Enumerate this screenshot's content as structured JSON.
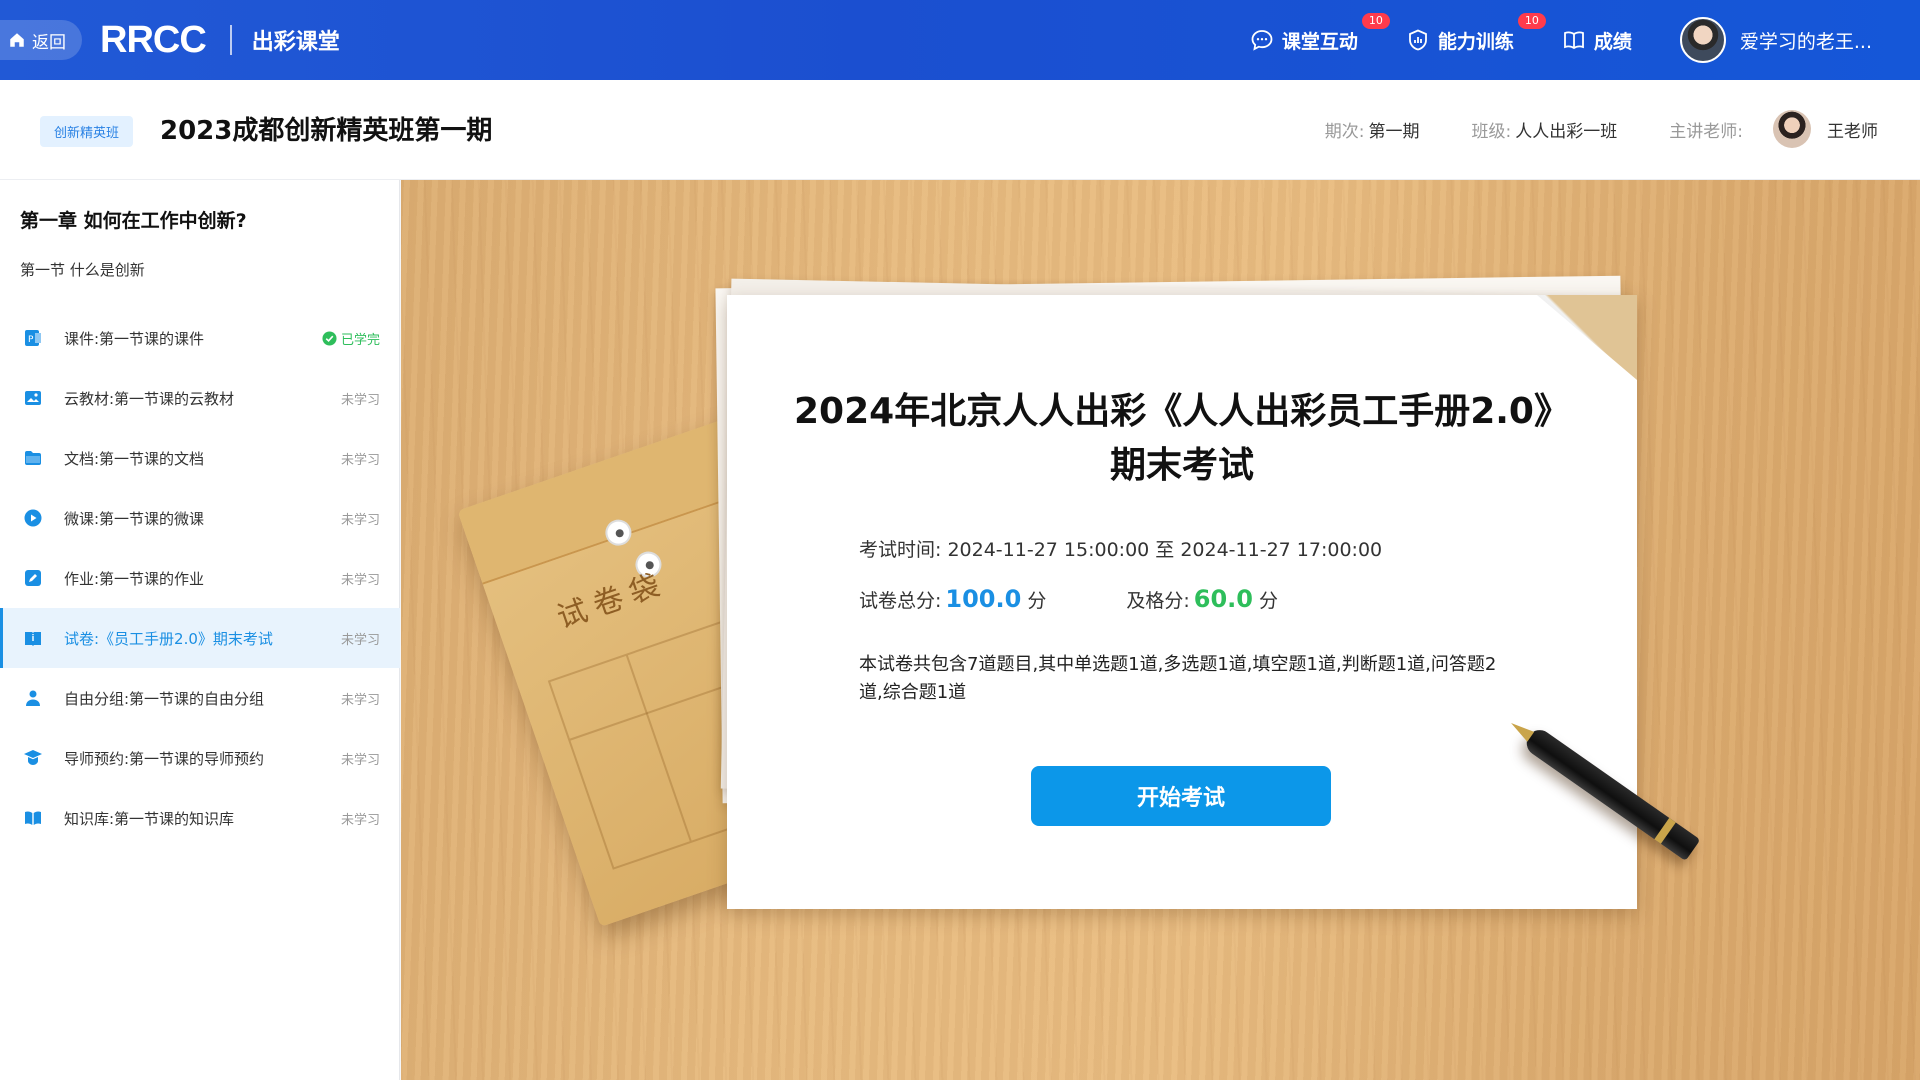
{
  "topbar": {
    "back_label": "返回",
    "logo_text": "RRCC",
    "logo_subtitle": "出彩课堂",
    "nav": [
      {
        "label": "课堂互动",
        "badge": "10"
      },
      {
        "label": "能力训练",
        "badge": "10"
      },
      {
        "label": "成绩",
        "badge": ""
      }
    ],
    "user_name": "爱学习的老王..."
  },
  "course": {
    "tag": "创新精英班",
    "title": "2023成都创新精英班第一期",
    "period_label": "期次:",
    "period_value": "第一期",
    "class_label": "班级:",
    "class_value": "人人出彩一班",
    "teacher_label": "主讲老师:",
    "teacher_value": "王老师"
  },
  "sidebar": {
    "chapter": "第一章  如何在工作中创新?",
    "section": "第一节  什么是创新",
    "items": [
      {
        "icon": "ppt-icon",
        "label": "课件:第一节课的课件",
        "status": "已学完",
        "done": true
      },
      {
        "icon": "image-icon",
        "label": "云教材:第一节课的云教材",
        "status": "未学习"
      },
      {
        "icon": "folder-icon",
        "label": "文档:第一节课的文档",
        "status": "未学习"
      },
      {
        "icon": "play-icon",
        "label": "微课:第一节课的微课",
        "status": "未学习"
      },
      {
        "icon": "edit-icon",
        "label": "作业:第一节课的作业",
        "status": "未学习"
      },
      {
        "icon": "exam-icon",
        "label": "试卷:《员工手册2.0》期末考试",
        "status": "未学习",
        "active": true
      },
      {
        "icon": "group-icon",
        "label": "自由分组:第一节课的自由分组",
        "status": "未学习"
      },
      {
        "icon": "mentor-icon",
        "label": "导师预约:第一节课的导师预约",
        "status": "未学习"
      },
      {
        "icon": "book-icon",
        "label": "知识库:第一节课的知识库",
        "status": "未学习"
      }
    ]
  },
  "exam": {
    "envelope_label": "试卷袋",
    "title_line1": "2024年北京人人出彩《人人出彩员工手册2.0》",
    "title_line2": "期末考试",
    "time_label": "考试时间:",
    "time_value": "2024-11-27 15:00:00  至 2024-11-27 17:00:00",
    "total_label": "试卷总分:",
    "total_value": "100.0",
    "pass_label": "及格分:",
    "pass_value": "60.0",
    "unit": "分",
    "description": "本试卷共包含7道题目,其中单选题1道,多选题1道,填空题1道,判断题1道,问答题2道,综合题1道",
    "start_button": "开始考试"
  },
  "colors": {
    "topbar": "#1b4fd0",
    "accent": "#1a8fe3",
    "success": "#2ebe5b",
    "badge": "#ff3b4c",
    "button": "#0c97e9"
  }
}
